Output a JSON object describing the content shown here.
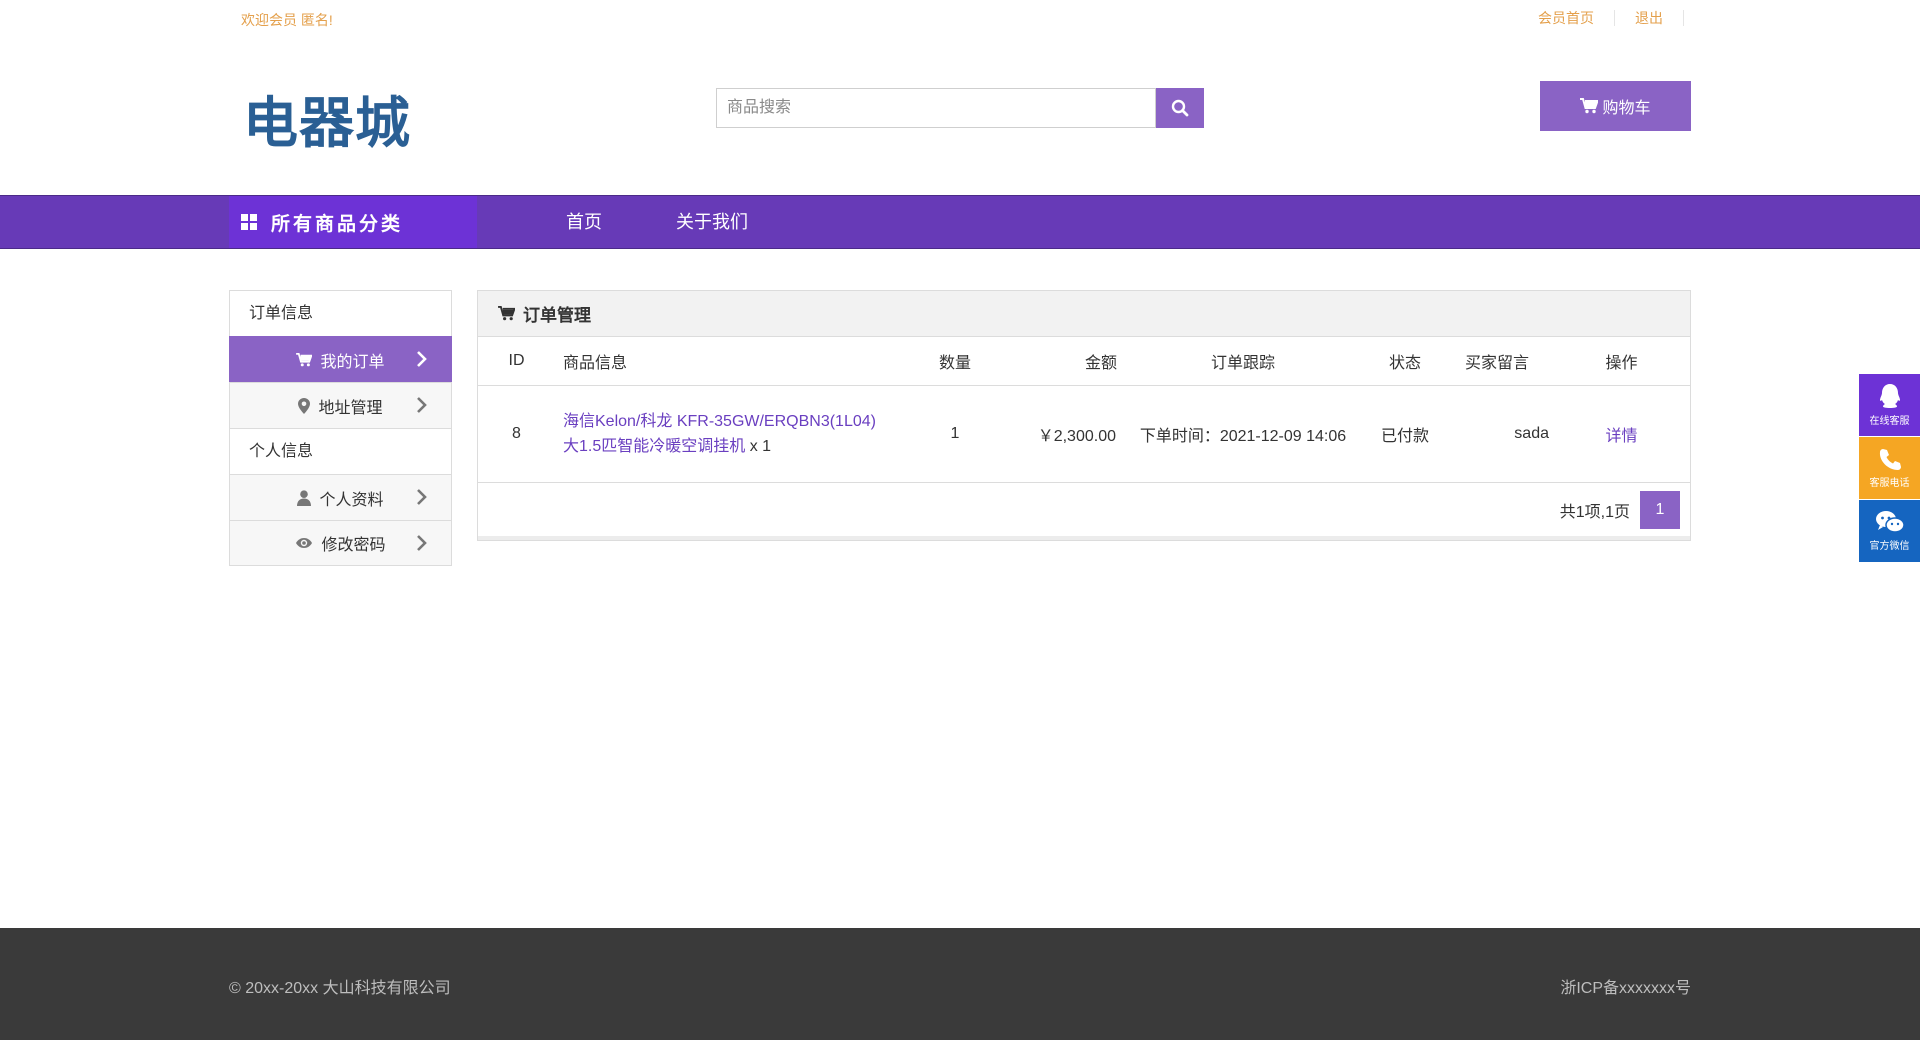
{
  "topbar": {
    "welcome": "欢迎会员 匿名!",
    "member_home": "会员首页",
    "logout": "退出"
  },
  "brand": {
    "logo_text": "电器城"
  },
  "search": {
    "placeholder": "商品搜索",
    "icon": "search-icon"
  },
  "cart": {
    "label": "购物车",
    "icon": "cart-icon"
  },
  "nav": {
    "all_categories": "所有商品分类",
    "links": [
      "首页",
      "关于我们"
    ]
  },
  "sidebar": {
    "section1": "订单信息",
    "my_orders": "我的订单",
    "address": "地址管理",
    "section2": "个人信息",
    "profile": "个人资料",
    "password": "修改密码"
  },
  "orders": {
    "title": "订单管理",
    "columns": [
      "ID",
      "商品信息",
      "数量",
      "金额",
      "订单跟踪",
      "状态",
      "买家留言",
      "操作"
    ],
    "rows": [
      {
        "id": "8",
        "product": "海信Kelon/科龙 KFR-35GW/ERQBN3(1L04) 大1.5匹智能冷暖空调挂机",
        "product_qty": "x 1",
        "qty": "1",
        "amount": "￥2,300.00",
        "tracking": "下单时间：2021-12-09 14:06",
        "status": "已付款",
        "message": "sada",
        "action": "详情"
      }
    ],
    "pager": {
      "summary": "共1项,1页",
      "current": "1"
    }
  },
  "float_bar": [
    {
      "label": "在线客服",
      "icon": "qq-icon",
      "color": "#6d32d6"
    },
    {
      "label": "客服电话",
      "icon": "phone-icon",
      "color": "#f5a623"
    },
    {
      "label": "官方微信",
      "icon": "wechat-icon",
      "color": "#1565c0"
    }
  ],
  "footer": {
    "copyright": "© 20xx-20xx 大山科技有限公司",
    "icp": "浙ICP备xxxxxxx号"
  },
  "colors": {
    "primary": "#8a63c5",
    "nav": "#673ab7",
    "accent_link": "#e4a04c",
    "footer_bg": "#3a3a3a"
  }
}
